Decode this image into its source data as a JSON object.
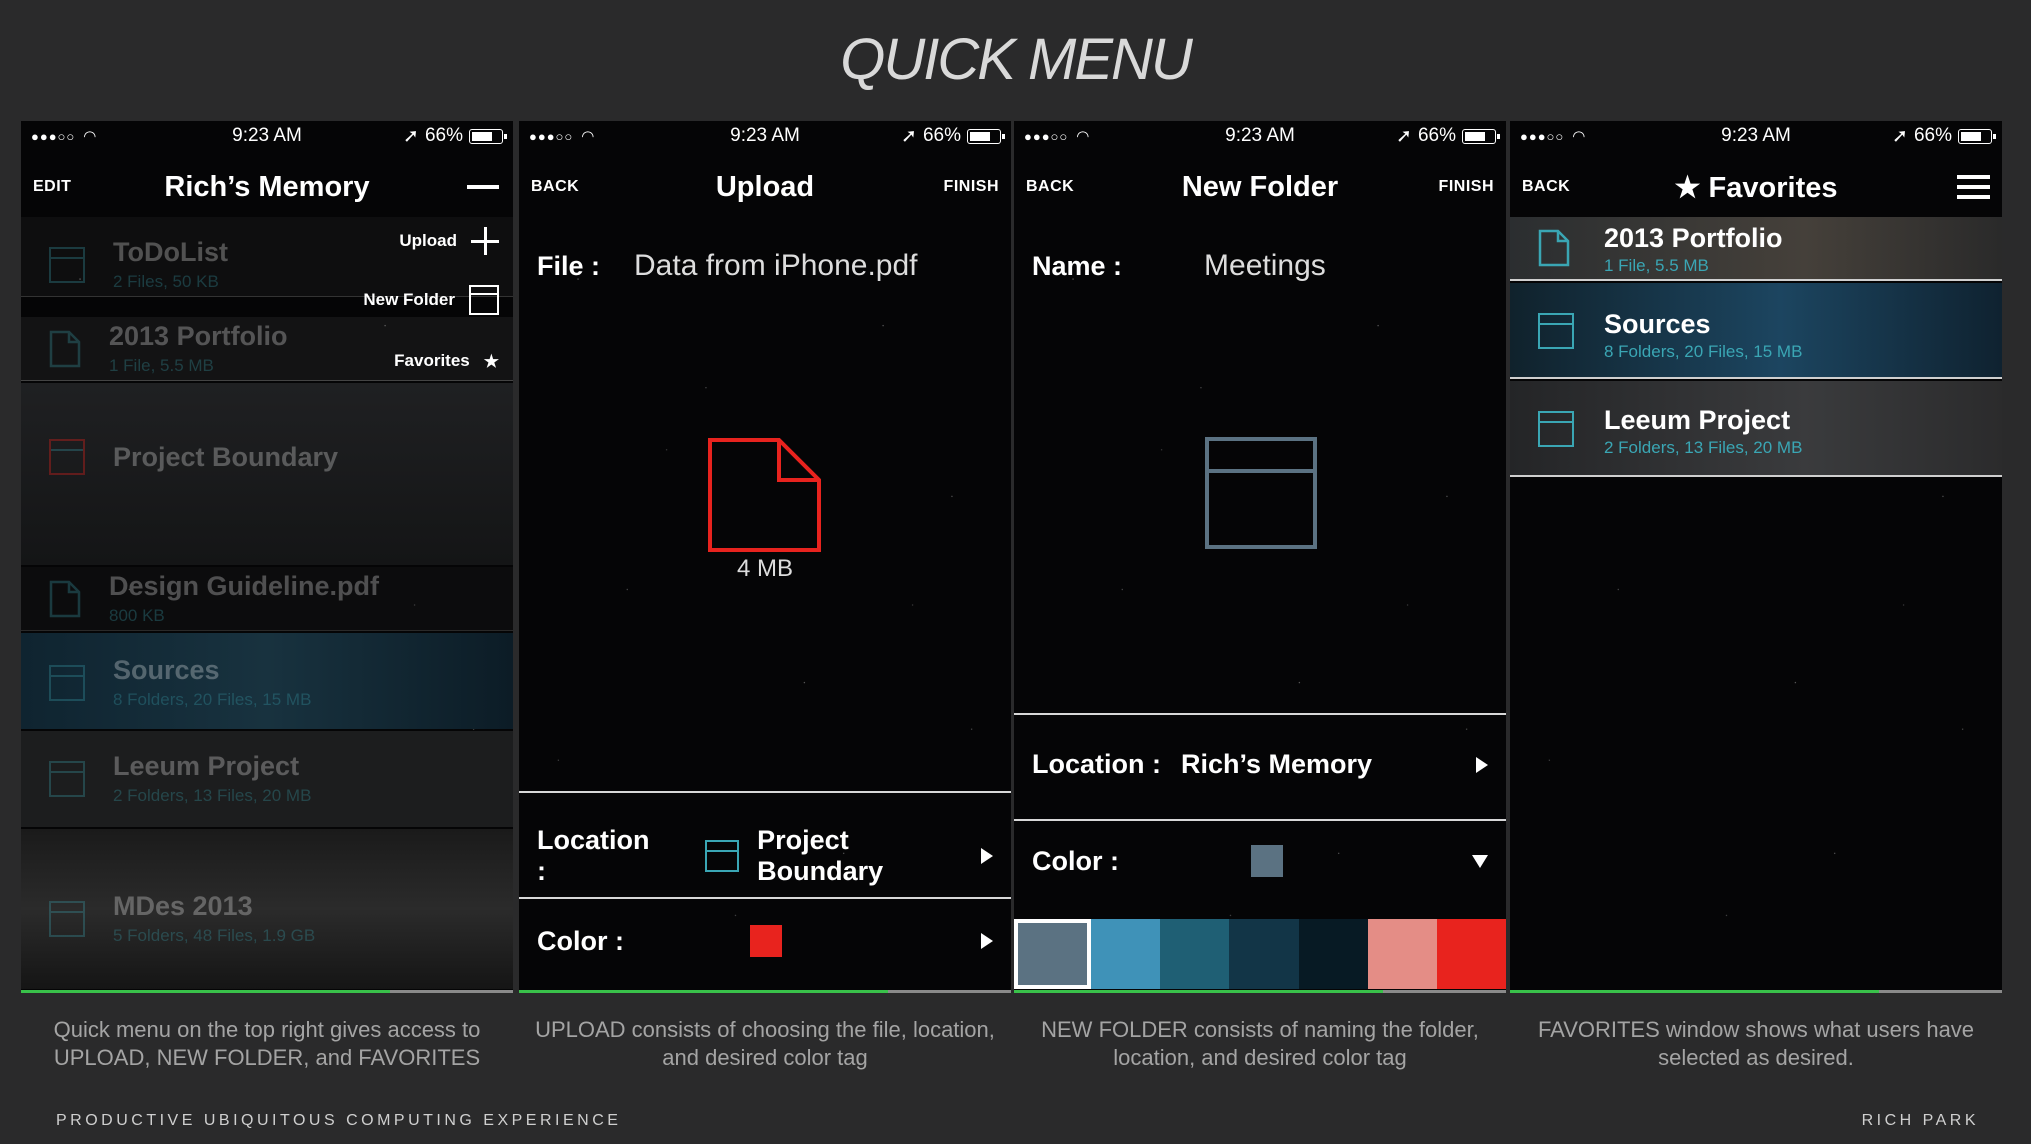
{
  "page": {
    "title": "QUICK MENU",
    "footer_left": "PRODUCTIVE UBIQUITOUS COMPUTING EXPERIENCE",
    "footer_right": "RICH PARK"
  },
  "statusbar": {
    "signal": "●●●○○",
    "time": "9:23 AM",
    "battery": "66%"
  },
  "screen1": {
    "left": "EDIT",
    "title": "Rich’s Memory",
    "quick_menu": [
      {
        "label": "Upload",
        "icon": "plus-icon"
      },
      {
        "label": "New Folder",
        "icon": "folder-icon"
      },
      {
        "label": "Favorites",
        "icon": "star-icon"
      }
    ],
    "items": [
      {
        "name": "ToDoList",
        "meta": "2 Files, 50 KB",
        "icon": "folder-icon"
      },
      {
        "name": "2013 Portfolio",
        "meta": "1 File, 5.5 MB",
        "icon": "file-icon"
      },
      {
        "name": "Project Boundary",
        "meta": "",
        "icon": "folder-icon"
      },
      {
        "name": "Design Guideline.pdf",
        "meta": "800 KB",
        "icon": "file-icon"
      },
      {
        "name": "Sources",
        "meta": "8 Folders, 20 Files, 15 MB",
        "icon": "folder-icon"
      },
      {
        "name": "Leeum Project",
        "meta": "2 Folders, 13 Files, 20 MB",
        "icon": "folder-icon"
      },
      {
        "name": "MDes 2013",
        "meta": "5 Folders, 48 Files, 1.9 GB",
        "icon": "folder-icon"
      }
    ],
    "progress": 0.75
  },
  "screen2": {
    "left": "BACK",
    "title": "Upload",
    "right": "FINISH",
    "file_label": "File :",
    "file_value": "Data from iPhone.pdf",
    "file_size": "4 MB",
    "location_label": "Location :",
    "location_value": "Project Boundary",
    "color_label": "Color :",
    "selected_color": "#e8231e",
    "progress": 0.75
  },
  "screen3": {
    "left": "BACK",
    "title": "New Folder",
    "right": "FINISH",
    "name_label": "Name :",
    "name_value": "Meetings",
    "location_label": "Location :",
    "location_value": "Rich’s Memory",
    "color_label": "Color :",
    "selected_color": "#5b7282",
    "palette": [
      "#5b7282",
      "#3f92b8",
      "#1f5f74",
      "#123547",
      "#071a24",
      "#e48d86",
      "#e8231e"
    ],
    "progress": 0.75
  },
  "screen4": {
    "left": "BACK",
    "title": "★ Favorites",
    "items": [
      {
        "name": "2013 Portfolio",
        "meta": "1 File, 5.5 MB",
        "icon": "file-icon"
      },
      {
        "name": "Sources",
        "meta": "8 Folders, 20 Files, 15 MB",
        "icon": "folder-icon"
      },
      {
        "name": "Leeum Project",
        "meta": "2 Folders, 13 Files, 20 MB",
        "icon": "folder-icon"
      }
    ],
    "progress": 0.75
  },
  "captions": [
    "Quick menu on the top right gives access to UPLOAD, NEW FOLDER, and FAVORITES",
    "UPLOAD consists of choosing the file, location, and desired color tag",
    "NEW FOLDER  consists of naming the folder, location, and desired color tag",
    "FAVORITES window shows what users have selected as desired."
  ],
  "colors": {
    "accent_teal": "#3aa6b4",
    "progress_green": "#39c14a",
    "background": "#2a2a2b"
  }
}
